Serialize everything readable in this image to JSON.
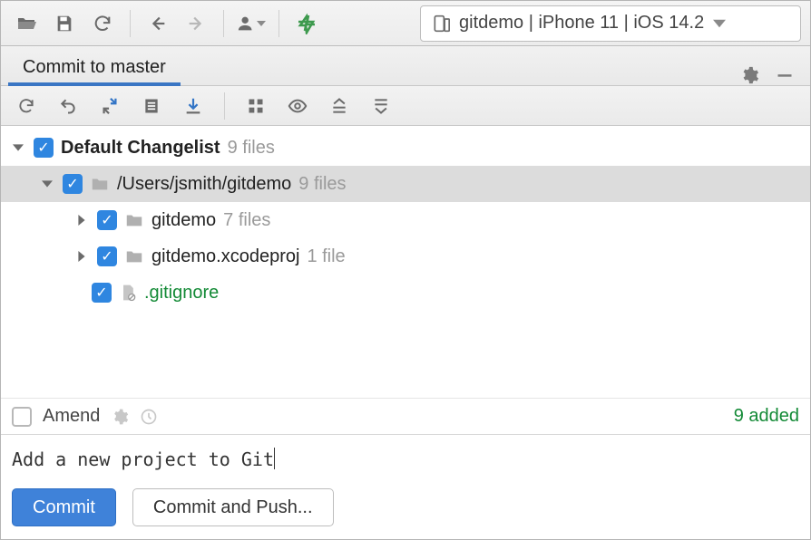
{
  "toolbar": {
    "run_config_text": "gitdemo | iPhone 11 | iOS 14.2"
  },
  "tab": {
    "title": "Commit to master"
  },
  "changes": {
    "root": {
      "label": "Default Changelist",
      "count": "9 files"
    },
    "path": {
      "label": "/Users/jsmith/gitdemo",
      "count": "9 files"
    },
    "items": [
      {
        "label": "gitdemo",
        "count": "7 files",
        "type": "folder"
      },
      {
        "label": "gitdemo.xcodeproj",
        "count": "1 file",
        "type": "folder"
      },
      {
        "label": ".gitignore",
        "type": "file-green"
      }
    ]
  },
  "amend": {
    "label": "Amend",
    "status": "9 added"
  },
  "message": {
    "text": "Add a new project to Git"
  },
  "buttons": {
    "commit": "Commit",
    "commit_push": "Commit and Push..."
  }
}
